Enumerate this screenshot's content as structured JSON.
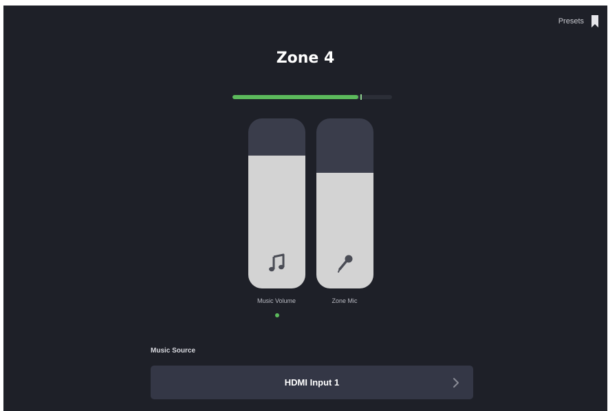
{
  "header": {
    "presets_label": "Presets",
    "presets_icon": "bookmark-icon"
  },
  "zone": {
    "title": "Zone 4"
  },
  "level_meter": {
    "level": 0.79,
    "peak": 0.8,
    "color": "#5cba5c"
  },
  "faders": [
    {
      "label": "Music Volume",
      "icon": "music-note-icon",
      "level": 0.78
    },
    {
      "label": "Zone Mic",
      "icon": "microphone-icon",
      "level": 0.68
    }
  ],
  "pager": {
    "count": 1,
    "active": 0
  },
  "music_source": {
    "heading": "Music Source",
    "value": "HDMI Input 1",
    "icon": "chevron-right-icon"
  },
  "colors": {
    "background": "#1e2028",
    "accent": "#5cba5c",
    "fader_track": "#3a3d4b",
    "fader_fill": "#d3d3d3",
    "button": "#343746"
  }
}
